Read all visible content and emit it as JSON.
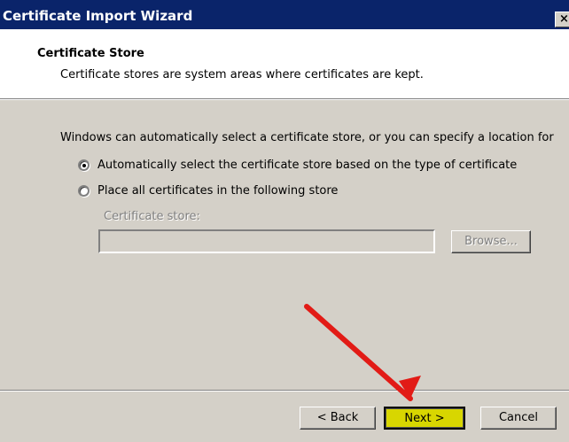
{
  "window": {
    "title": "Certificate Import Wizard",
    "close_glyph": "×"
  },
  "header": {
    "title": "Certificate Store",
    "subtitle": "Certificate stores are system areas where certificates are kept."
  },
  "body": {
    "description": "Windows can automatically select a certificate store, or you can specify a location for"
  },
  "options": [
    {
      "label": "Automatically select the certificate store based on the type of certificate",
      "selected": true
    },
    {
      "label": "Place all certificates in the following store",
      "selected": false
    }
  ],
  "certificate_store": {
    "label": "Certificate store:",
    "value": "",
    "enabled": false
  },
  "buttons": {
    "browse": "Browse...",
    "back": "< Back",
    "next": "Next >",
    "cancel": "Cancel"
  },
  "annotation": {
    "icon": "red-arrow-icon",
    "color": "#e21b16",
    "target": "next-button"
  },
  "colors": {
    "titlebar": "#0a246a",
    "dialog": "#d4d0c8",
    "next_highlight": "#d8d600"
  }
}
